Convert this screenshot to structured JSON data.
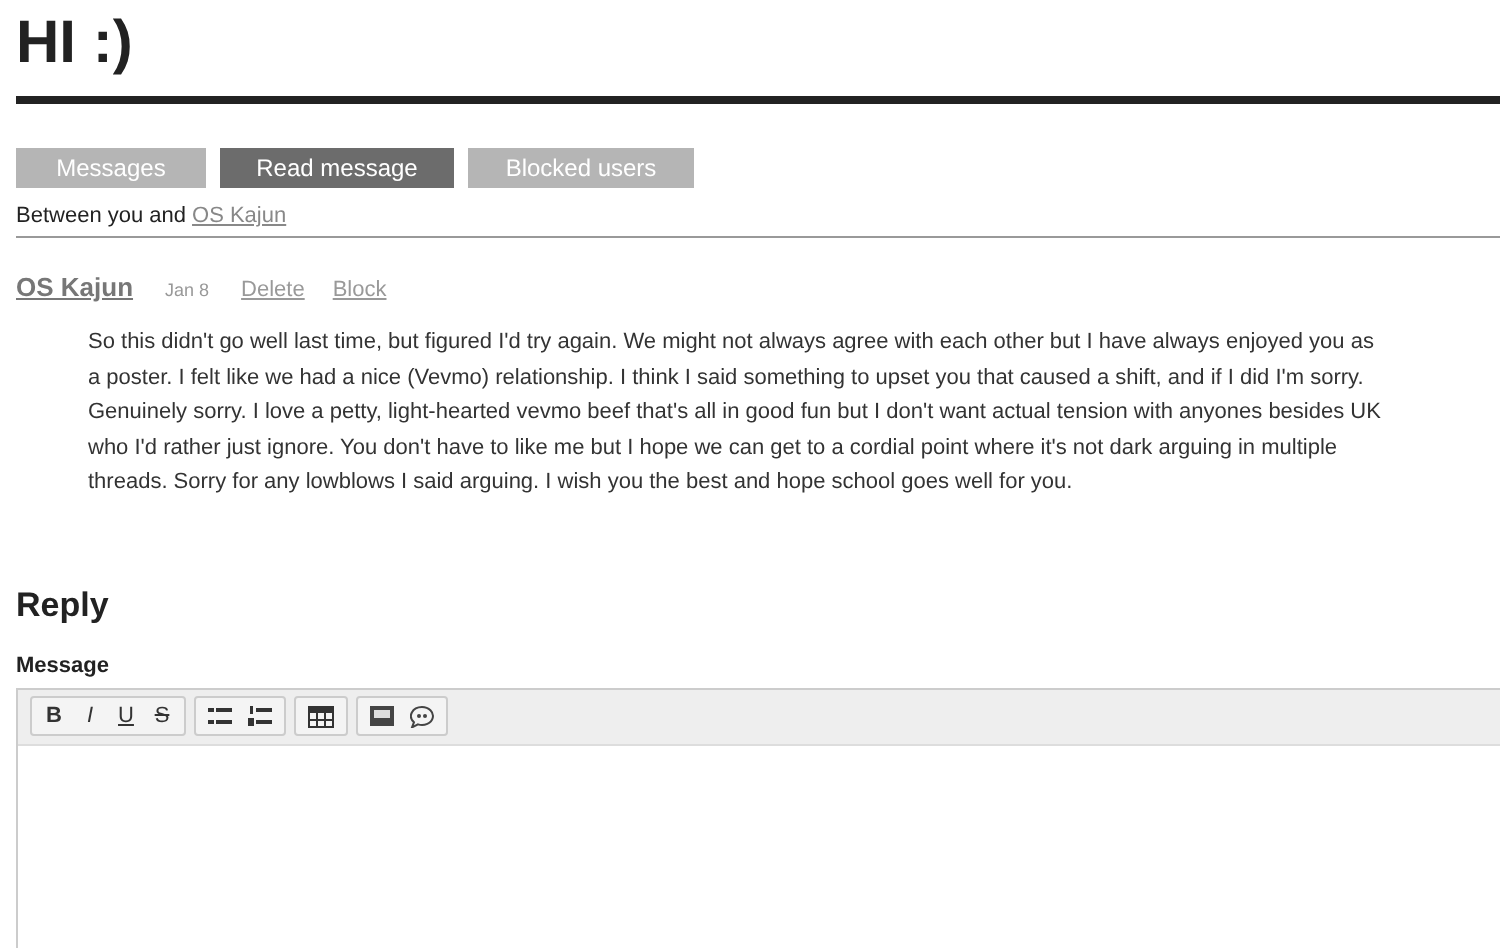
{
  "title": "HI :)",
  "tabs": [
    {
      "label": "Messages",
      "selected": false
    },
    {
      "label": "Read message",
      "selected": true
    },
    {
      "label": "Blocked users",
      "selected": false
    }
  ],
  "between": {
    "text": "Between you and",
    "user": "OS Kajun"
  },
  "message": {
    "author": "OS Kajun",
    "date": "Jan 8",
    "actions": [
      "Delete",
      "Block"
    ],
    "body": "So this didn't go well last time, but figured I'd try again. We might not always agree with each other but I have always enjoyed you as a poster. I felt like we had a nice (Vevmo) relationship. I think I said something to upset you that caused a shift, and if I did I'm sorry. Genuinely sorry. I love a petty, light-hearted  vevmo beef that's all in good fun but I don't want actual tension with anyones besides UK who I'd rather just ignore. You don't have to like me but I hope we can get to a cordial point where it's not dark arguing in multiple threads. Sorry for any lowblows I said arguing. I wish you the best and hope school goes well for you."
  },
  "reply": {
    "heading": "Reply",
    "label": "Message",
    "format_buttons": [
      {
        "label": "B",
        "kind": "bold"
      },
      {
        "label": "I",
        "kind": "italic"
      },
      {
        "label": "U",
        "kind": "underline"
      },
      {
        "label": "S",
        "kind": "strike"
      }
    ]
  }
}
